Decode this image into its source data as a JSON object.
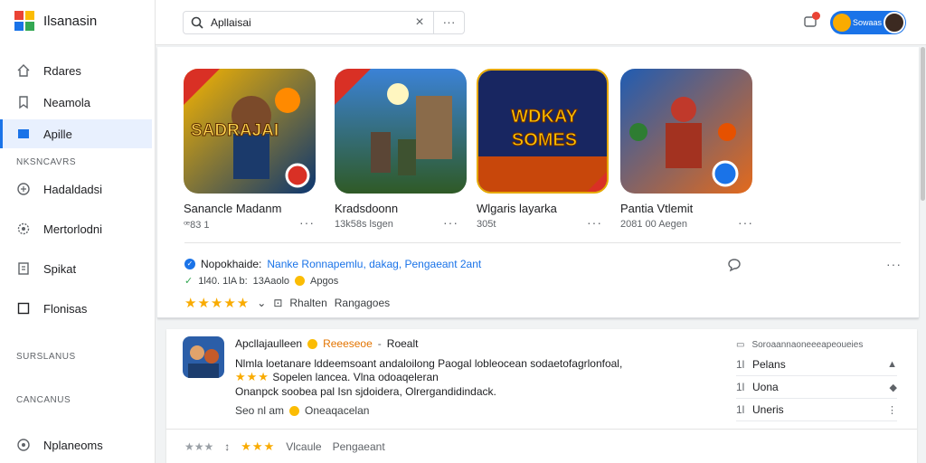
{
  "app": {
    "title": "Ilsanasin"
  },
  "sidebar": {
    "items_top": [
      {
        "label": "Rdares",
        "icon": "home-icon"
      },
      {
        "label": "Neamola",
        "icon": "bookmark-icon"
      },
      {
        "label": "Apille",
        "icon": "apps-icon",
        "active": true
      }
    ],
    "section1": "NKSNCAVRS",
    "items_mid": [
      {
        "label": "Hadaldadsi",
        "icon": "grid-icon"
      },
      {
        "label": "Mertorlodni",
        "icon": "settings-icon"
      },
      {
        "label": "Spikat",
        "icon": "book-icon"
      },
      {
        "label": "Flonisas",
        "icon": "square-icon"
      }
    ],
    "section2": "SURSLANUS",
    "section3": "CANCANUS",
    "item_bottom": {
      "label": "Nplaneoms",
      "icon": "info-icon"
    }
  },
  "search": {
    "value": "Apllaisai",
    "clear": "×",
    "more": "···"
  },
  "account": {
    "name": "Sowaas"
  },
  "cards": [
    {
      "title": "Sanancle Madanm",
      "meta": "ꟹ83 1",
      "art_text": "SADRAJAI",
      "bg": [
        "#f4a300",
        "#0b3a78"
      ]
    },
    {
      "title": "Kradsdoonn",
      "meta": "13k58s lsgen",
      "art_text": "",
      "bg": [
        "#3a7bd5",
        "#2e4b23"
      ]
    },
    {
      "title": "Wlgaris layarka",
      "meta": "305t",
      "art_text": "WDKAY SOMES",
      "bg": [
        "#1e2b6b",
        "#d94f0a"
      ]
    },
    {
      "title": "Pantia Vtlemit",
      "meta": "2081 00 Aegen",
      "art_text": "",
      "bg": [
        "#1d4fa0",
        "#e06b1f"
      ]
    }
  ],
  "review": {
    "source": "Nopokhaide:",
    "link_text": "Nanke Ronnapemlu, dakag, Pengaeant 2ant",
    "sub1": "1l40. 1lA b:",
    "sub2": "13Aaolo",
    "sub3": "Apgos",
    "stars": "★★★★★",
    "star_caret": "⌄",
    "reply_label": "Rhalten",
    "reply_sub": "Rangagoes"
  },
  "lower": {
    "title": "Apcllajaulleen",
    "badge": "Reeeseoe",
    "handle": "Roealt",
    "line1": "Nlmla loetanare lddeemsoant andaloilong Paogal lobleocean sodaetofagrlonfoal,",
    "line2_stars": "★★★",
    "line2": "Sopelen lancea. Vlna odoaqeleran",
    "line3": "Onanpck soobea pal Isn sjdoidera, Olrergandidindack.",
    "foot_text": "Seo nl am",
    "foot_sub": "Oneaqacelan",
    "bottom_stars": "★★★",
    "bottom_label1": "Vlcaule",
    "bottom_label2": "Pengaeant",
    "side_title": "Soroaannaoneeeapeoueies",
    "side_rows": [
      {
        "num": "1l",
        "label": "Pelans",
        "icon": "▲"
      },
      {
        "num": "1l",
        "label": "Uona",
        "icon": "◆"
      },
      {
        "num": "1l",
        "label": "Uneris",
        "icon": "⋮"
      }
    ]
  }
}
